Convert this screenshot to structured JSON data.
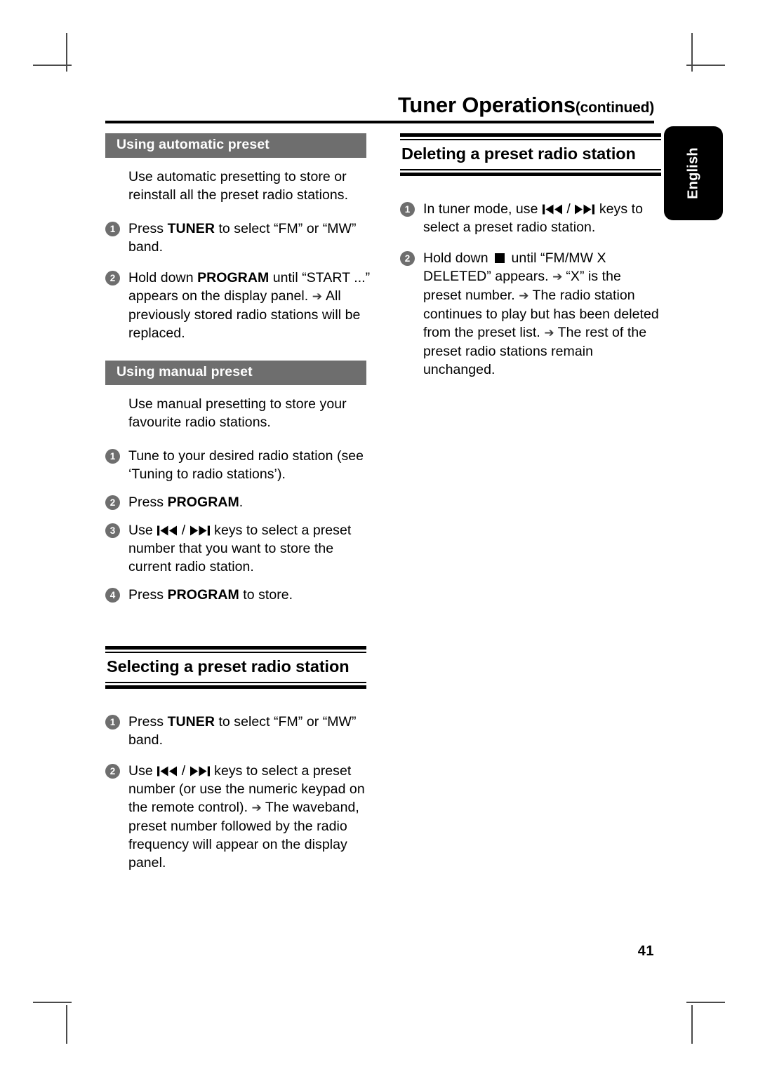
{
  "page": {
    "title_main": "Tuner Operations",
    "title_continued": "(continued)",
    "folio": "41",
    "language_tab": "English"
  },
  "left_column": {
    "auto_preset": {
      "heading": "Using automatic preset",
      "intro": "Use automatic presetting to store or reinstall all the preset radio stations.",
      "steps": [
        {
          "num": "1",
          "pre": "Press ",
          "bold": "TUNER",
          "post": " to select “FM” or “MW” band."
        },
        {
          "num": "2",
          "pre": "Hold down ",
          "bold": "PROGRAM",
          "post": " until “START ...” appears on the display panel.",
          "result": "All previously stored radio stations will be replaced."
        }
      ]
    },
    "manual_preset": {
      "heading": "Using manual preset",
      "intro": "Use manual presetting to store your favourite radio stations.",
      "step1": "Tune to your desired radio station (see ‘Tuning to radio stations’).",
      "step2_pre": "Press ",
      "step2_bold": "PROGRAM",
      "step2_post": ".",
      "step3_pre": "Use ",
      "step3_mid": " keys to select a preset number that you want to store the current radio station.",
      "step4_pre": "Press ",
      "step4_bold": "PROGRAM",
      "step4_post": " to store."
    },
    "selecting": {
      "heading": "Selecting a preset radio station",
      "step1_pre": "Press ",
      "step1_bold": "TUNER",
      "step1_post": " to select “FM” or “MW” band.",
      "step2_pre": "Use ",
      "step2_post": " keys to select a preset number (or use the numeric keypad on the remote control).",
      "step2_result": "The waveband, preset number followed by the radio frequency will appear on the display panel."
    }
  },
  "right_column": {
    "deleting": {
      "heading": "Deleting a preset radio station",
      "step1_pre": "In tuner mode, use ",
      "step1_post": " keys to select a preset radio station.",
      "step2_pre": "Hold down ",
      "step2_post": " until “FM/MW X DELETED” appears.",
      "results": [
        "“X” is the preset number.",
        "The radio station continues to play but has been deleted from the preset list.",
        "The rest of the preset radio stations remain unchanged."
      ]
    }
  },
  "icons": {
    "arrow": "➔",
    "prev": "prev-track-icon",
    "next": "next-track-icon",
    "stop": "stop-icon"
  },
  "colors": {
    "grey_bar": "#6e6e6e",
    "rule": "#000000",
    "tab_bg": "#000000"
  },
  "numbers": {
    "n1": "1",
    "n2": "2",
    "n3": "3",
    "n4": "4"
  }
}
